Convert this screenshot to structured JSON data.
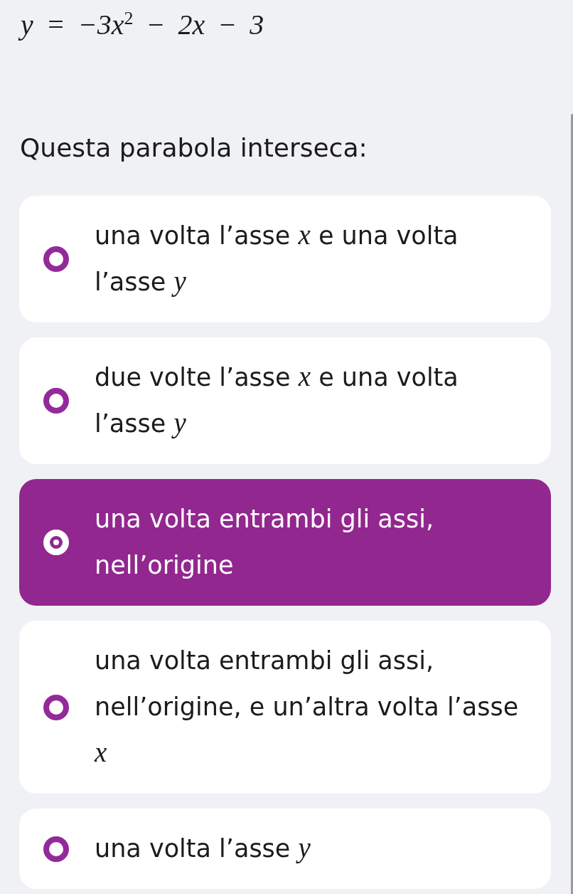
{
  "formula": "y = −3x$^{2}$ − 2x − 3",
  "question": "Questa parabola interseca:",
  "options": [
    {
      "text": "una volta l’asse *x* e una volta l’asse *y*",
      "selected": false
    },
    {
      "text": "due volte l’asse *x* e una volta l’asse *y*",
      "selected": false
    },
    {
      "text": "una volta entrambi gli assi, nell’origine",
      "selected": true
    },
    {
      "text": "una volta entrambi gli assi, nell’origine, e un’altra volta l’asse *x*",
      "selected": false
    },
    {
      "text": "una volta l’asse *y*",
      "selected": false
    }
  ]
}
